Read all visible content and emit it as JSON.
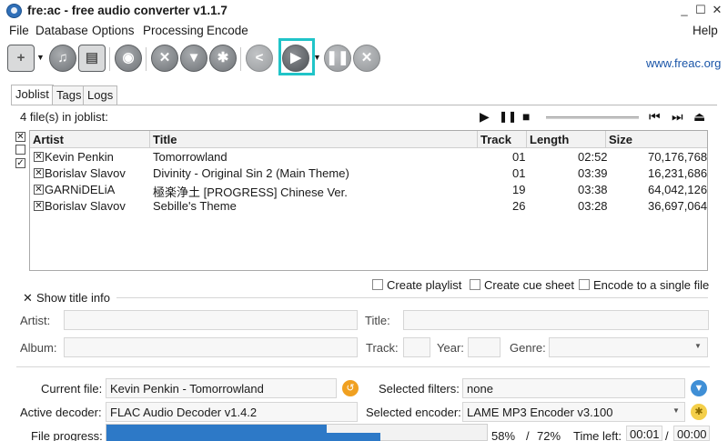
{
  "window": {
    "title": "fre:ac - free audio converter v1.1.7",
    "minimize": "_",
    "maximize": "☐",
    "close": "✕"
  },
  "menu": [
    "File",
    "Database",
    "Options",
    "Processing",
    "Encode",
    "Help"
  ],
  "toolbar": {
    "link": "www.freac.org",
    "icons": [
      "add-files-icon",
      "add-cd-icon",
      "add-folder-icon",
      "cddb-query-icon",
      "configure-icon",
      "filter-icon",
      "settings-icon",
      "share-icon",
      "start-encoding-icon",
      "pause-icon",
      "stop-icon"
    ]
  },
  "tabs": [
    "Joblist",
    "Tags",
    "Logs"
  ],
  "joblist": {
    "count_label": "4 file(s) in joblist:",
    "columns": [
      "Artist",
      "Title",
      "Track",
      "Length",
      "Size"
    ],
    "rows": [
      {
        "artist": "Kevin Penkin",
        "title": "Tomorrowland",
        "track": "01",
        "length": "02:52",
        "size": "70,176,768"
      },
      {
        "artist": "Borislav Slavov",
        "title": "Divinity - Original Sin 2 (Main Theme)",
        "track": "01",
        "length": "03:39",
        "size": "16,231,686"
      },
      {
        "artist": "GARNiDELiA",
        "title": "極楽浄土 [PROGRESS] Chinese Ver.",
        "track": "19",
        "length": "03:38",
        "size": "64,042,126"
      },
      {
        "artist": "Borislav Slavov",
        "title": "Sebille's Theme",
        "track": "26",
        "length": "03:28",
        "size": "36,697,064"
      }
    ]
  },
  "options": {
    "create_playlist": "Create playlist",
    "create_cue": "Create cue sheet",
    "single_file": "Encode to a single file"
  },
  "title_info": {
    "show_label": "Show title info",
    "artist_label": "Artist:",
    "title_label": "Title:",
    "album_label": "Album:",
    "track_label": "Track:",
    "year_label": "Year:",
    "genre_label": "Genre:"
  },
  "status": {
    "current_file_label": "Current file:",
    "current_file": "Kevin Penkin - Tomorrowland",
    "selected_filters_label": "Selected filters:",
    "selected_filters": "none",
    "active_decoder_label": "Active decoder:",
    "active_decoder": "FLAC Audio Decoder v1.4.2",
    "selected_encoder_label": "Selected encoder:",
    "selected_encoder": "LAME MP3 Encoder v3.100",
    "file_progress_label": "File progress:",
    "file_progress": 0.58,
    "total_progress": 0.72,
    "file_progress_text": "58%",
    "progress_slash": "/",
    "total_progress_text": "72%",
    "time_left_label": "Time left:",
    "time_left": "00:01",
    "time_total": "00:00"
  },
  "colors": {
    "accent": "#20c4c8",
    "progress": "#2d79c7",
    "link": "#1a55a8"
  }
}
